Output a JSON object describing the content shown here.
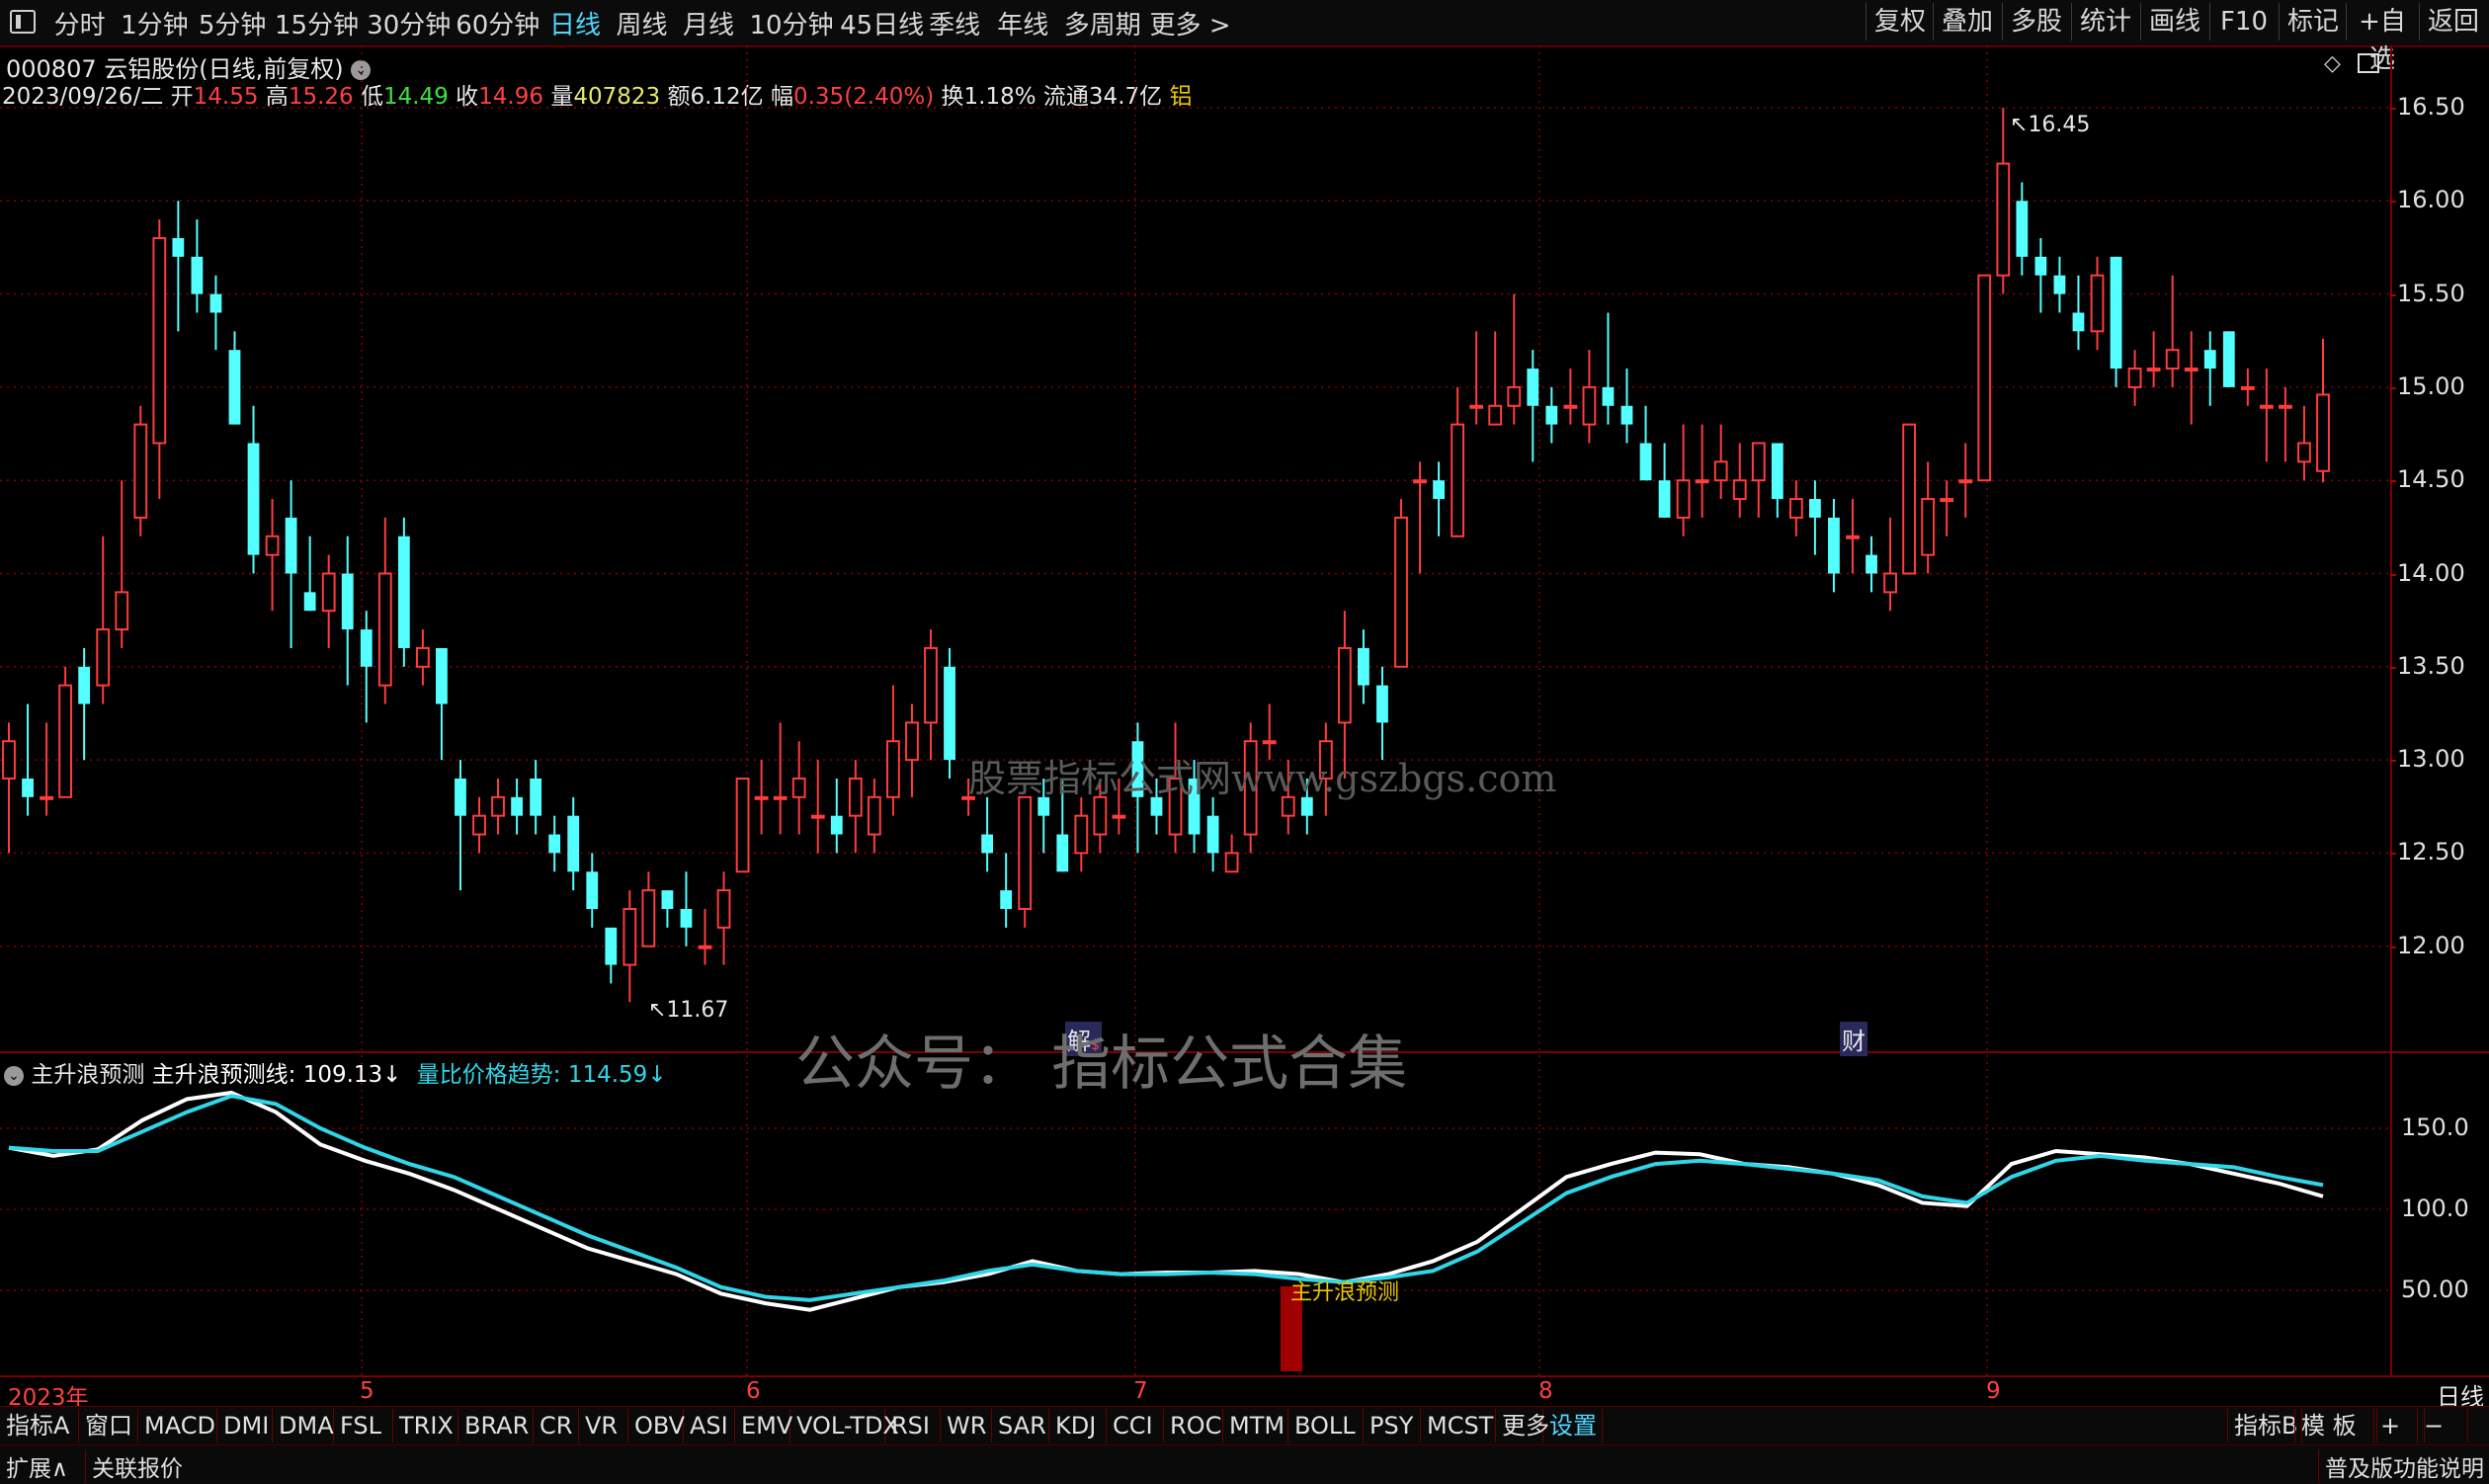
{
  "toolbar": {
    "left_icon": "panel-toggle-icon",
    "periods": [
      "分时",
      "1分钟",
      "5分钟",
      "15分钟",
      "30分钟",
      "60分钟",
      "日线",
      "周线",
      "月线",
      "10分钟",
      "45日线",
      "季线",
      "年线",
      "多周期",
      "更多 >"
    ],
    "active_period": "日线",
    "right_buttons": [
      "复权",
      "叠加",
      "多股",
      "统计",
      "画线",
      "F10",
      "标记",
      "+自选",
      "返回"
    ]
  },
  "stock": {
    "title": "000807 云铝股份(日线,前复权)",
    "date": "2023/09/26/二",
    "open_label": "开",
    "open": "14.55",
    "high_label": "高",
    "high": "15.26",
    "low_label": "低",
    "low": "14.49",
    "close_label": "收",
    "close": "14.96",
    "vol_label": "量",
    "vol": "407823",
    "amount_label": "额",
    "amount": "6.12亿",
    "change_label": "幅",
    "change": "0.35(2.40%)",
    "turnover_label": "换",
    "turnover": "1.18%",
    "float_label": "流通",
    "float": "34.7亿",
    "tag": "铝"
  },
  "price_axis": [
    "16.50",
    "16.00",
    "15.50",
    "15.00",
    "14.50",
    "14.00",
    "13.50",
    "13.00",
    "12.50",
    "12.00"
  ],
  "markers": {
    "high": "16.45",
    "low": "11.67",
    "event1": "解",
    "event2": "财"
  },
  "watermark_center": "股票指标公式网www.gszbgs.com",
  "watermark_big": "公众号： 指标公式合集",
  "indicator": {
    "name": "主升浪预测",
    "line1_label": "主升浪预测线:",
    "line1_value": "109.13",
    "line1_arrow": "↓",
    "line2_label": "量比价格趋势:",
    "line2_value": "114.59",
    "line2_arrow": "↓",
    "signal_text": "主升浪预测",
    "axis": [
      "150.0",
      "100.0",
      "50.00"
    ]
  },
  "date_axis": [
    "2023年",
    "5",
    "6",
    "7",
    "8",
    "9"
  ],
  "period_label": "日线",
  "indicator_tabs": [
    "指标A",
    "窗口",
    "MACD",
    "DMI",
    "DMA",
    "FSL",
    "TRIX",
    "BRAR",
    "CR",
    "VR",
    "OBV",
    "ASI",
    "EMV",
    "VOL-TDX",
    "RSI",
    "WR",
    "SAR",
    "KDJ",
    "CCI",
    "ROC",
    "MTM",
    "BOLL",
    "PSY",
    "MCST",
    "更多",
    "设置"
  ],
  "tabs_right": [
    "指标B",
    "模 板",
    "+",
    "−"
  ],
  "bottom": {
    "left1": "扩展∧",
    "left2": "关联报价",
    "right": "普及版功能说明"
  },
  "colors": {
    "up": "#ff3c3c",
    "down": "#54ffff",
    "line_white": "#ffffff",
    "line_cyan": "#2fd6e8",
    "grid": "#8a0000"
  },
  "chart_data": [
    {
      "type": "candlestick",
      "title": "000807 云铝股份(日线,前复权)",
      "y_range": [
        11.5,
        16.7
      ],
      "x_ticks": [
        "2023年",
        "5",
        "6",
        "7",
        "8",
        "9"
      ],
      "ohlc": [
        [
          12.9,
          13.2,
          12.5,
          13.1
        ],
        [
          12.9,
          13.3,
          12.7,
          12.8
        ],
        [
          12.8,
          13.2,
          12.7,
          12.8
        ],
        [
          12.8,
          13.5,
          12.8,
          13.4
        ],
        [
          13.5,
          13.6,
          13.0,
          13.3
        ],
        [
          13.4,
          14.2,
          13.3,
          13.7
        ],
        [
          13.7,
          14.5,
          13.6,
          13.9
        ],
        [
          14.3,
          14.9,
          14.2,
          14.8
        ],
        [
          14.7,
          15.9,
          14.4,
          15.8
        ],
        [
          15.8,
          16.0,
          15.3,
          15.7
        ],
        [
          15.7,
          15.9,
          15.4,
          15.5
        ],
        [
          15.5,
          15.6,
          15.2,
          15.4
        ],
        [
          15.2,
          15.3,
          14.8,
          14.8
        ],
        [
          14.7,
          14.9,
          14.0,
          14.1
        ],
        [
          14.1,
          14.4,
          13.8,
          14.2
        ],
        [
          14.3,
          14.5,
          13.6,
          14.0
        ],
        [
          13.9,
          14.2,
          13.8,
          13.8
        ],
        [
          13.8,
          14.1,
          13.6,
          14.0
        ],
        [
          14.0,
          14.2,
          13.4,
          13.7
        ],
        [
          13.7,
          13.8,
          13.2,
          13.5
        ],
        [
          13.4,
          14.3,
          13.3,
          14.0
        ],
        [
          14.2,
          14.3,
          13.5,
          13.6
        ],
        [
          13.5,
          13.7,
          13.4,
          13.6
        ],
        [
          13.6,
          13.6,
          13.0,
          13.3
        ],
        [
          12.9,
          13.0,
          12.3,
          12.7
        ],
        [
          12.6,
          12.8,
          12.5,
          12.7
        ],
        [
          12.7,
          12.9,
          12.6,
          12.8
        ],
        [
          12.8,
          12.9,
          12.6,
          12.7
        ],
        [
          12.9,
          13.0,
          12.6,
          12.7
        ],
        [
          12.6,
          12.7,
          12.4,
          12.5
        ],
        [
          12.7,
          12.8,
          12.3,
          12.4
        ],
        [
          12.4,
          12.5,
          12.1,
          12.2
        ],
        [
          12.1,
          12.1,
          11.8,
          11.9
        ],
        [
          11.9,
          12.3,
          11.7,
          12.2
        ],
        [
          12.0,
          12.4,
          12.0,
          12.3
        ],
        [
          12.3,
          12.3,
          12.1,
          12.2
        ],
        [
          12.2,
          12.4,
          12.0,
          12.1
        ],
        [
          12.0,
          12.2,
          11.9,
          12.0
        ],
        [
          12.1,
          12.4,
          11.9,
          12.3
        ],
        [
          12.4,
          12.9,
          12.4,
          12.9
        ],
        [
          12.8,
          13.0,
          12.6,
          12.8
        ],
        [
          12.8,
          13.2,
          12.6,
          12.8
        ],
        [
          12.8,
          13.1,
          12.6,
          12.9
        ],
        [
          12.7,
          13.0,
          12.5,
          12.7
        ],
        [
          12.7,
          12.9,
          12.5,
          12.6
        ],
        [
          12.7,
          13.0,
          12.5,
          12.9
        ],
        [
          12.6,
          12.9,
          12.5,
          12.8
        ],
        [
          12.8,
          13.4,
          12.7,
          13.1
        ],
        [
          13.0,
          13.3,
          12.8,
          13.2
        ],
        [
          13.2,
          13.7,
          13.0,
          13.6
        ],
        [
          13.5,
          13.6,
          12.9,
          13.0
        ],
        [
          12.8,
          12.9,
          12.7,
          12.8
        ],
        [
          12.6,
          12.8,
          12.4,
          12.5
        ],
        [
          12.3,
          12.5,
          12.1,
          12.2
        ],
        [
          12.2,
          12.8,
          12.1,
          12.8
        ],
        [
          12.8,
          12.9,
          12.5,
          12.7
        ],
        [
          12.6,
          12.9,
          12.4,
          12.4
        ],
        [
          12.5,
          12.8,
          12.4,
          12.7
        ],
        [
          12.6,
          12.9,
          12.5,
          12.8
        ],
        [
          12.7,
          12.9,
          12.6,
          12.7
        ],
        [
          13.1,
          13.2,
          12.5,
          12.8
        ],
        [
          12.8,
          12.9,
          12.6,
          12.7
        ],
        [
          12.6,
          13.2,
          12.5,
          12.9
        ],
        [
          12.9,
          13.0,
          12.5,
          12.6
        ],
        [
          12.7,
          12.8,
          12.4,
          12.5
        ],
        [
          12.4,
          12.6,
          12.4,
          12.5
        ],
        [
          12.6,
          13.2,
          12.5,
          13.1
        ],
        [
          13.1,
          13.3,
          13.0,
          13.1
        ],
        [
          12.7,
          13.0,
          12.6,
          12.8
        ],
        [
          12.8,
          12.9,
          12.6,
          12.7
        ],
        [
          12.9,
          13.2,
          12.7,
          13.1
        ],
        [
          13.2,
          13.8,
          12.9,
          13.6
        ],
        [
          13.6,
          13.7,
          13.3,
          13.4
        ],
        [
          13.4,
          13.5,
          13.0,
          13.2
        ],
        [
          13.5,
          14.4,
          13.5,
          14.3
        ],
        [
          14.5,
          14.6,
          14.0,
          14.5
        ],
        [
          14.5,
          14.6,
          14.2,
          14.4
        ],
        [
          14.2,
          15.0,
          14.2,
          14.8
        ],
        [
          14.9,
          15.3,
          14.8,
          14.9
        ],
        [
          14.8,
          15.3,
          14.8,
          14.9
        ],
        [
          14.9,
          15.5,
          14.8,
          15.0
        ],
        [
          15.1,
          15.2,
          14.6,
          14.9
        ],
        [
          14.9,
          15.0,
          14.7,
          14.8
        ],
        [
          14.9,
          15.1,
          14.8,
          14.9
        ],
        [
          14.8,
          15.2,
          14.7,
          15.0
        ],
        [
          15.0,
          15.4,
          14.8,
          14.9
        ],
        [
          14.9,
          15.1,
          14.7,
          14.8
        ],
        [
          14.7,
          14.9,
          14.5,
          14.5
        ],
        [
          14.5,
          14.7,
          14.3,
          14.3
        ],
        [
          14.3,
          14.8,
          14.2,
          14.5
        ],
        [
          14.5,
          14.8,
          14.3,
          14.5
        ],
        [
          14.5,
          14.8,
          14.4,
          14.6
        ],
        [
          14.4,
          14.7,
          14.3,
          14.5
        ],
        [
          14.5,
          14.7,
          14.3,
          14.7
        ],
        [
          14.7,
          14.7,
          14.3,
          14.4
        ],
        [
          14.3,
          14.5,
          14.2,
          14.4
        ],
        [
          14.4,
          14.5,
          14.1,
          14.3
        ],
        [
          14.3,
          14.4,
          13.9,
          14.0
        ],
        [
          14.2,
          14.4,
          14.0,
          14.2
        ],
        [
          14.1,
          14.2,
          13.9,
          14.0
        ],
        [
          13.9,
          14.3,
          13.8,
          14.0
        ],
        [
          14.0,
          14.8,
          14.0,
          14.8
        ],
        [
          14.1,
          14.6,
          14.0,
          14.4
        ],
        [
          14.4,
          14.5,
          14.2,
          14.4
        ],
        [
          14.5,
          14.7,
          14.3,
          14.5
        ],
        [
          14.5,
          15.6,
          14.5,
          15.6
        ],
        [
          15.6,
          16.5,
          15.5,
          16.2
        ],
        [
          16.0,
          16.1,
          15.6,
          15.7
        ],
        [
          15.7,
          15.8,
          15.4,
          15.6
        ],
        [
          15.6,
          15.7,
          15.4,
          15.5
        ],
        [
          15.4,
          15.6,
          15.2,
          15.3
        ],
        [
          15.3,
          15.7,
          15.2,
          15.6
        ],
        [
          15.7,
          15.7,
          15.0,
          15.1
        ],
        [
          15.0,
          15.2,
          14.9,
          15.1
        ],
        [
          15.1,
          15.3,
          15.0,
          15.1
        ],
        [
          15.1,
          15.6,
          15.0,
          15.2
        ],
        [
          15.1,
          15.3,
          14.8,
          15.1
        ],
        [
          15.2,
          15.3,
          14.9,
          15.1
        ],
        [
          15.3,
          15.3,
          15.0,
          15.0
        ],
        [
          15.0,
          15.1,
          14.9,
          15.0
        ],
        [
          14.9,
          15.1,
          14.6,
          14.9
        ],
        [
          14.9,
          15.0,
          14.6,
          14.9
        ],
        [
          14.6,
          14.9,
          14.5,
          14.7
        ],
        [
          14.55,
          15.26,
          14.49,
          14.96
        ]
      ]
    },
    {
      "type": "line",
      "title": "主升浪预测",
      "y_range": [
        0,
        190
      ],
      "series": [
        {
          "name": "主升浪预测线",
          "values": [
            138,
            133,
            137,
            155,
            168,
            172,
            160,
            140,
            130,
            122,
            112,
            100,
            88,
            76,
            68,
            60,
            48,
            42,
            38,
            45,
            52,
            55,
            60,
            68,
            62,
            60,
            61,
            61,
            62,
            60,
            55,
            60,
            68,
            80,
            100,
            120,
            128,
            135,
            134,
            128,
            126,
            122,
            115,
            104,
            102,
            128,
            136,
            134,
            132,
            128,
            122,
            116,
            108
          ]
        },
        {
          "name": "量比价格趋势",
          "values": [
            138,
            136,
            136,
            148,
            160,
            170,
            165,
            150,
            138,
            128,
            120,
            108,
            96,
            84,
            74,
            64,
            52,
            46,
            44,
            48,
            52,
            56,
            62,
            66,
            62,
            60,
            60,
            61,
            60,
            57,
            55,
            58,
            62,
            74,
            92,
            110,
            120,
            128,
            130,
            128,
            125,
            122,
            118,
            108,
            104,
            120,
            130,
            133,
            130,
            128,
            126,
            120,
            115
          ]
        }
      ],
      "signal": {
        "label": "主升浪预测",
        "position": "late June",
        "value": 50
      }
    }
  ]
}
